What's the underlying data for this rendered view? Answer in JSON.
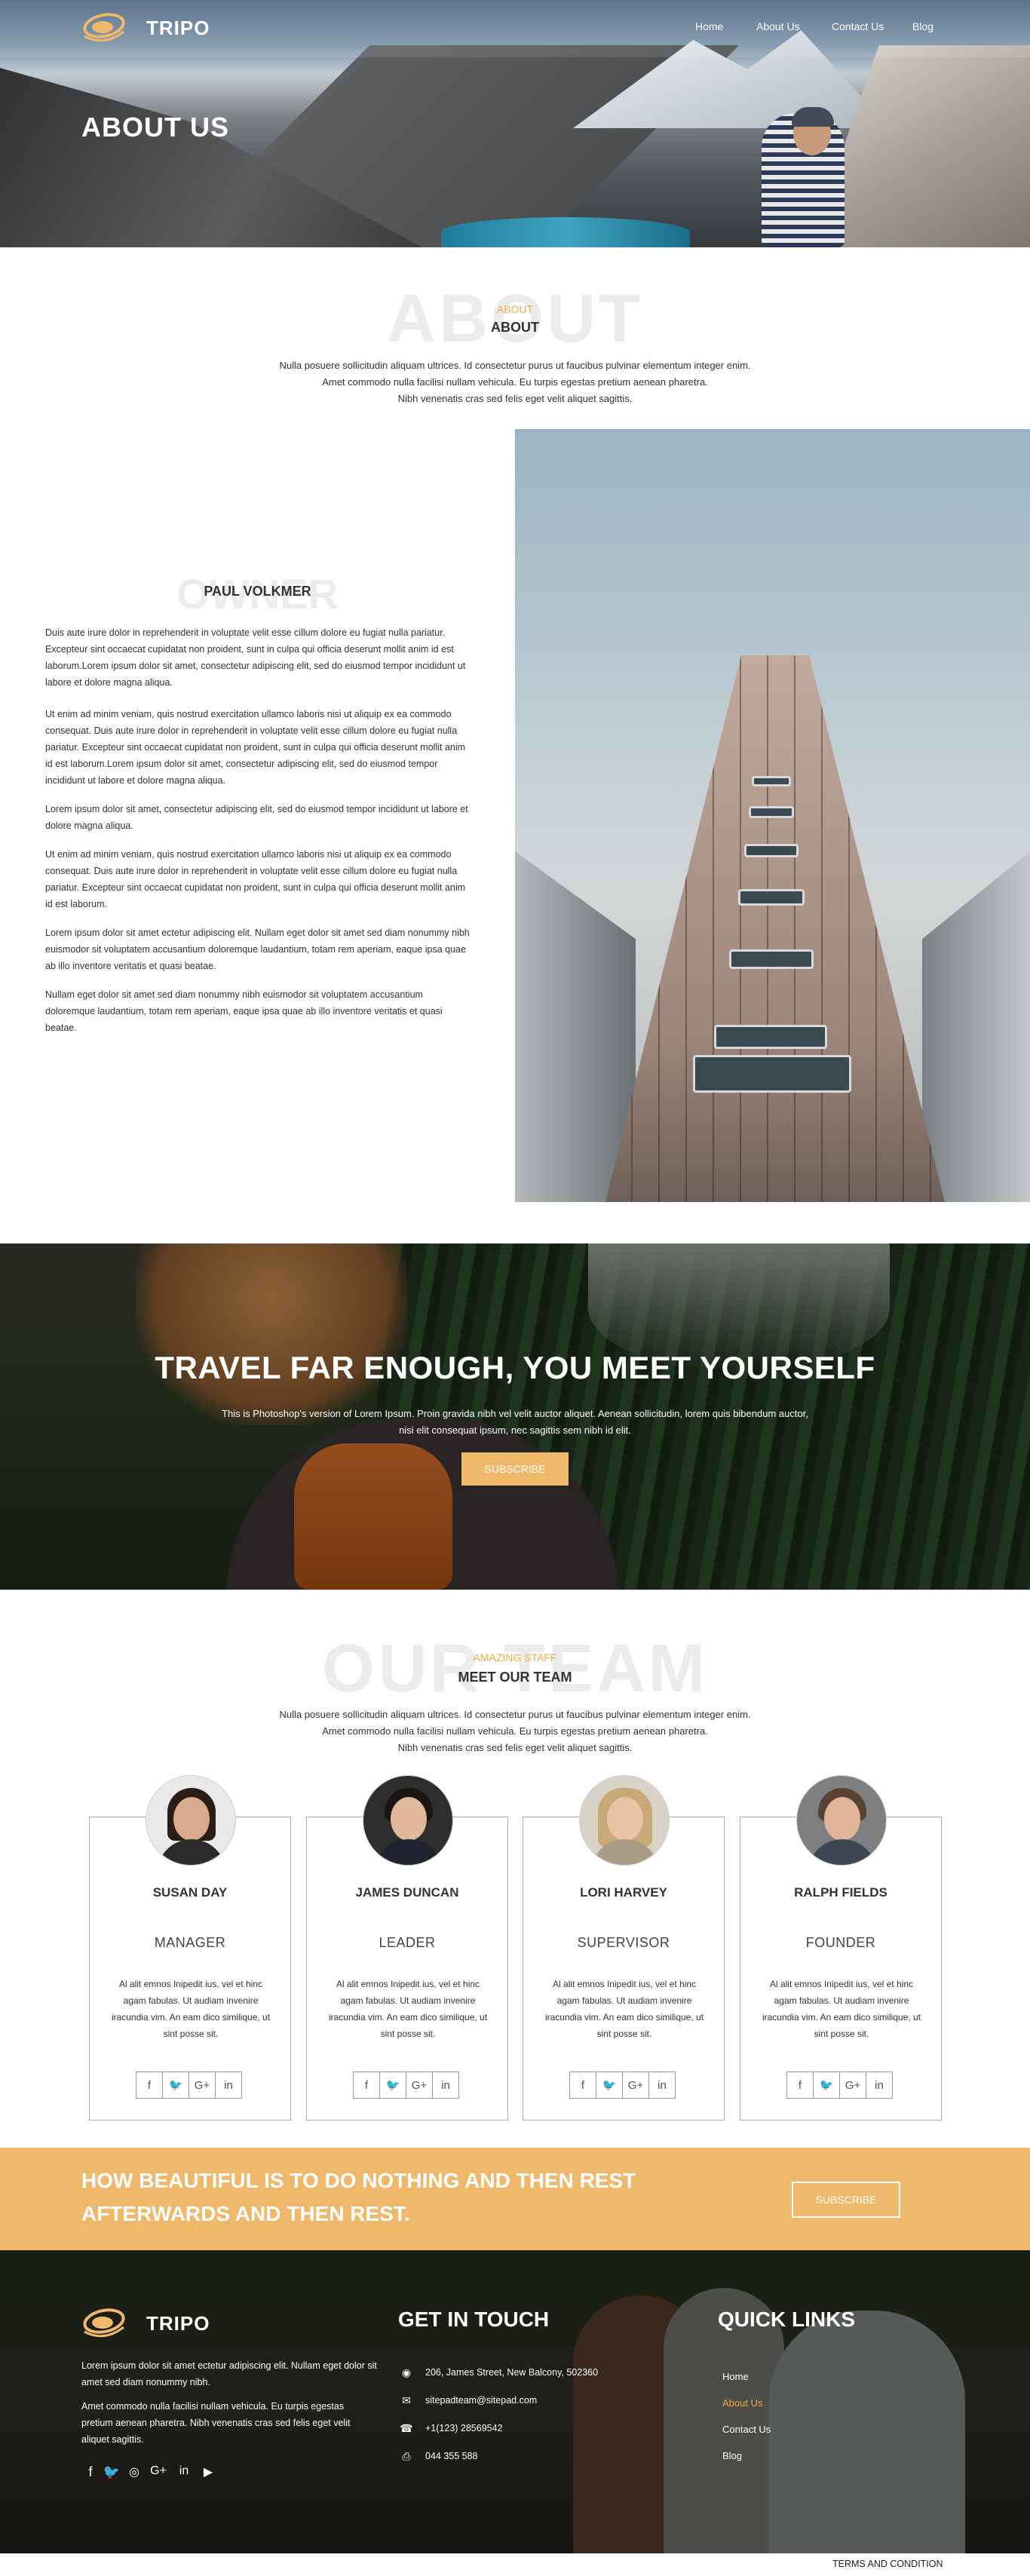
{
  "brand": {
    "name": "TRIPO"
  },
  "nav": {
    "items": [
      "Home",
      "About Us",
      "Contact Us",
      "Blog"
    ]
  },
  "hero": {
    "title": "ABOUT US"
  },
  "about": {
    "bg_word": "ABOUT",
    "tag": "ABOUT",
    "title": "ABOUT",
    "desc": [
      "Nulla posuere sollicitudin aliquam ultrices. Id consectetur purus ut faucibus pulvinar elementum integer enim.",
      "Amet commodo nulla facilisi nullam vehicula. Eu turpis egestas pretium aenean pharetra.",
      "Nibh venenatis cras sed felis eget velit aliquet sagittis."
    ]
  },
  "owner": {
    "bg_word": "OWNER",
    "name": "PAUL VOLKMER",
    "paragraphs": [
      "Duis aute irure dolor in reprehenderit in voluptate velit esse cillum dolore eu fugiat nulla pariatur. Excepteur sint occaecat cupidatat non proident, sunt in culpa qui officia deserunt mollit anim id est laborum.Lorem ipsum dolor sit amet, consectetur adipiscing elit, sed do eiusmod tempor incididunt ut labore et dolore magna aliqua.",
      "Ut enim ad minim veniam, quis nostrud exercitation ullamco laboris nisi ut aliquip ex ea commodo consequat. Duis aute irure dolor in reprehenderit in voluptate velit esse cillum dolore eu fugiat nulla pariatur. Excepteur sint occaecat cupidatat non proident, sunt in culpa qui officia deserunt mollit anim id est laborum.Lorem ipsum dolor sit amet, consectetur adipiscing elit, sed do eiusmod tempor incididunt ut labore et dolore magna aliqua.",
      "Lorem ipsum dolor sit amet, consectetur adipiscing elit, sed do eiusmod tempor incididunt ut labore et dolore magna aliqua.",
      "Ut enim ad minim veniam, quis nostrud exercitation ullamco laboris nisi ut aliquip ex ea commodo consequat. Duis aute irure dolor in reprehenderit in voluptate velit esse cillum dolore eu fugiat nulla pariatur. Excepteur sint occaecat cupidatat non proident, sunt in culpa qui officia deserunt mollit anim id est laborum.",
      "Lorem ipsum dolor sit amet ectetur adipiscing elit. Nullam eget dolor sit amet sed diam nonummy nibh euismodor sit voluptatem accusantium doloremque laudantium, totam rem aperiam, eaque ipsa quae ab illo inventore veritatis et quasi beatae.",
      "Nullam eget dolor sit amet sed diam nonummy nibh euismodor sit voluptatem accusantium doloremque laudantium, totam rem aperiam, eaque ipsa quae ab illo inventore veritatis et quasi beatae."
    ]
  },
  "travel": {
    "title": "TRAVEL FAR ENOUGH, YOU MEET YOURSELF",
    "desc": [
      "This is Photoshop's version of Lorem Ipsum. Proin gravida nibh vel velit auctor aliquet. Aenean sollicitudin, lorem quis bibendum auctor,",
      "nisi elit consequat ipsum, nec sagittis sem nibh id elit."
    ],
    "button": "SUBSCRIBE"
  },
  "team": {
    "bg_word": "OUR TEAM",
    "tag": "AMAZING STAFF",
    "title": "MEET OUR TEAM",
    "desc": [
      "Nulla posuere sollicitudin aliquam ultrices. Id consectetur purus ut faucibus pulvinar elementum integer enim.",
      "Amet commodo nulla facilisi nullam vehicula. Eu turpis egestas pretium aenean pharetra.",
      "Nibh venenatis cras sed felis eget velit aliquet sagittis."
    ],
    "members": [
      {
        "name": "SUSAN DAY",
        "role": "MANAGER",
        "bio": "Al alit emnos Inipedit ius, vel et hinc agam fabulas. Ut audiam invenire iracundia vim. An eam dico similique, ut sint posse sit."
      },
      {
        "name": "JAMES DUNCAN",
        "role": "LEADER",
        "bio": "Al alit emnos Inipedit ius, vel et hinc agam fabulas. Ut audiam invenire iracundia vim. An eam dico similique, ut sint posse sit."
      },
      {
        "name": "LORI HARVEY",
        "role": "SUPERVISOR",
        "bio": "Al alit emnos Inipedit ius, vel et hinc agam fabulas. Ut audiam invenire iracundia vim. An eam dico similique, ut sint posse sit."
      },
      {
        "name": "RALPH FIELDS",
        "role": "FOUNDER",
        "bio": "Al alit emnos Inipedit ius, vel et hinc agam fabulas. Ut audiam invenire iracundia vim. An eam dico similique, ut sint posse sit."
      }
    ],
    "social_icons": [
      "facebook-icon",
      "twitter-icon",
      "google-plus-icon",
      "linkedin-icon"
    ]
  },
  "banner": {
    "lines": [
      "HOW BEAUTIFUL IS TO DO NOTHING AND THEN REST",
      "AFTERWARDS AND THEN REST."
    ],
    "button": "SUBSCRIBE"
  },
  "footer": {
    "brand": "TRIPO",
    "about_text": [
      "Lorem ipsum dolor sit amet ectetur adipiscing elit. Nullam eget dolor sit amet sed diam nonummy nibh.",
      "Amet commodo nulla facilisi nullam vehicula. Eu turpis egestas pretium aenean pharetra. Nibh venenatis cras sed felis eget velit aliquet sagittis."
    ],
    "social_icons": [
      "facebook-icon",
      "twitter-icon",
      "instagram-icon",
      "google-plus-icon",
      "linkedin-icon",
      "youtube-icon"
    ],
    "contact_title": "GET IN TOUCH",
    "contacts": [
      {
        "icon": "map-marker-icon",
        "text": "206, James Street, New Balcony, 502360"
      },
      {
        "icon": "envelope-icon",
        "text": "sitepadteam@sitepad.com"
      },
      {
        "icon": "phone-icon",
        "text": "+1(123) 28569542"
      },
      {
        "icon": "fax-icon",
        "text": "044 355 588"
      }
    ],
    "links_title": "QUICK LINKS",
    "links": [
      "Home",
      "About Us",
      "Contact Us",
      "Blog"
    ],
    "active_link_color": "#f2a942",
    "terms": "TERMS AND CONDITION"
  },
  "colors": {
    "accent": "#f0b86a",
    "tag": "#f2a942"
  }
}
